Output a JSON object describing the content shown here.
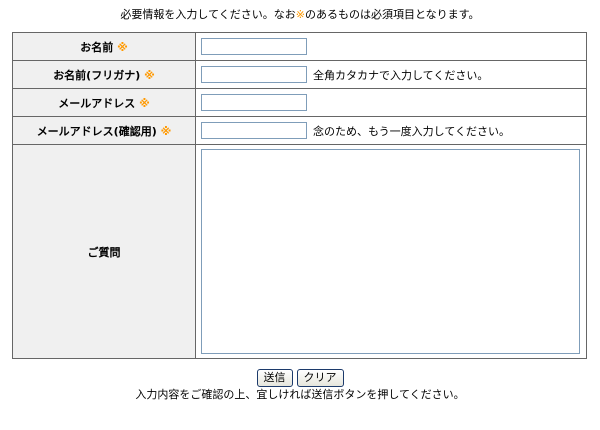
{
  "intro": {
    "before": "必要情報を入力してください。なお",
    "mark": "※",
    "after": "のあるものは必須項目となります。"
  },
  "fields": [
    {
      "label": "お名前",
      "mark": "※",
      "value": "",
      "note": ""
    },
    {
      "label": "お名前(フリガナ)",
      "mark": "※",
      "value": "",
      "note": "全角カタカナで入力してください。"
    },
    {
      "label": "メールアドレス",
      "mark": "※",
      "value": "",
      "note": ""
    },
    {
      "label": "メールアドレス(確認用)",
      "mark": "※",
      "value": "",
      "note": "念のため、もう一度入力してください。"
    }
  ],
  "question": {
    "label": "ご質問",
    "value": ""
  },
  "buttons": {
    "submit": "送信",
    "clear": "クリア"
  },
  "outro": "入力内容をご確認の上、宜しければ送信ボタンを押してください。",
  "colors": {
    "required_mark": "#ff9900",
    "label_bg": "#f0f0f0",
    "border": "#666666"
  }
}
